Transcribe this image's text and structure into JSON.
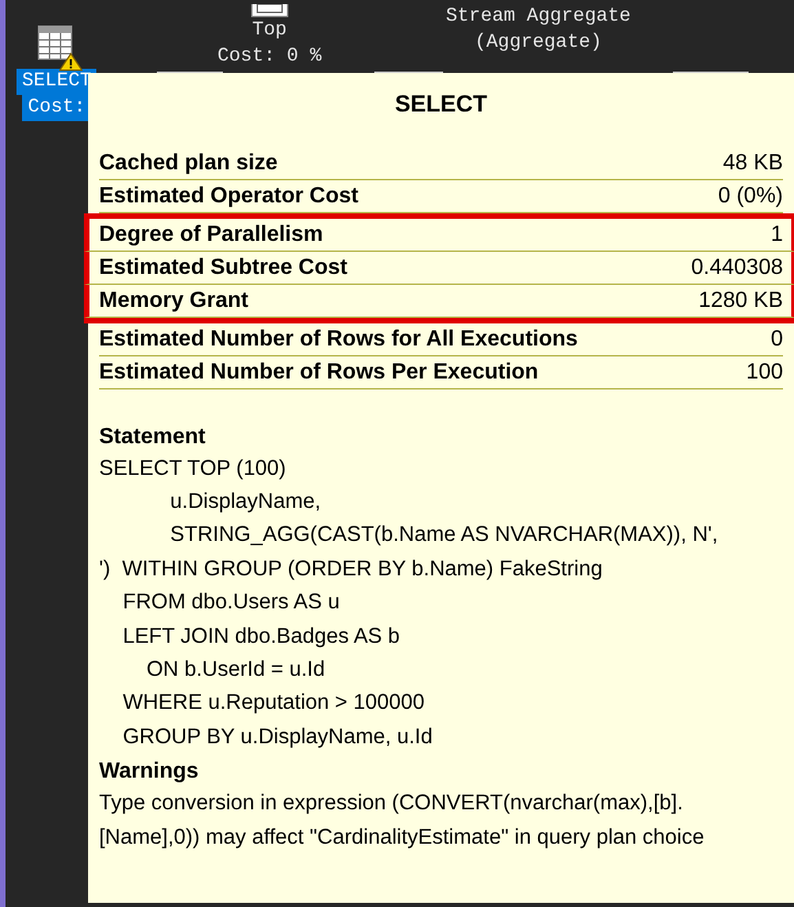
{
  "plan": {
    "nodes": [
      {
        "kind": "select",
        "selected": true,
        "lines": [
          "SELECT",
          "Cost:"
        ],
        "warning": true
      },
      {
        "kind": "top",
        "selected": false,
        "lines": [
          "Top",
          "Cost: 0 %"
        ]
      },
      {
        "kind": "aggregate",
        "selected": false,
        "lines": [
          "Stream Aggregate",
          "(Aggregate)"
        ]
      }
    ]
  },
  "tooltip": {
    "title": "SELECT",
    "properties": [
      {
        "label": "Cached plan size",
        "value": "48 KB",
        "highlighted": false
      },
      {
        "label": "Estimated Operator Cost",
        "value": "0 (0%)",
        "highlighted": false
      },
      {
        "label": "Degree of Parallelism",
        "value": "1",
        "highlighted": true
      },
      {
        "label": "Estimated Subtree Cost",
        "value": "0.440308",
        "highlighted": true
      },
      {
        "label": "Memory Grant",
        "value": "1280 KB",
        "highlighted": true
      },
      {
        "label": "Estimated Number of Rows for All Executions",
        "value": "0",
        "highlighted": false
      },
      {
        "label": "Estimated Number of Rows Per Execution",
        "value": "100",
        "highlighted": false
      }
    ],
    "sections": [
      {
        "heading": "Statement",
        "text": "SELECT TOP (100)\n            u.DisplayName,\n            STRING_AGG(CAST(b.Name AS NVARCHAR(MAX)), N',\n')  WITHIN GROUP (ORDER BY b.Name) FakeString\n    FROM dbo.Users AS u\n    LEFT JOIN dbo.Badges AS b\n        ON b.UserId = u.Id\n    WHERE u.Reputation > 100000\n    GROUP BY u.DisplayName, u.Id",
        "kind": "code"
      },
      {
        "heading": "Warnings",
        "text": "Type conversion in expression (CONVERT(nvarchar(max),[b].[Name],0)) may affect \"CardinalityEstimate\" in query plan choice",
        "kind": "prose"
      }
    ]
  }
}
